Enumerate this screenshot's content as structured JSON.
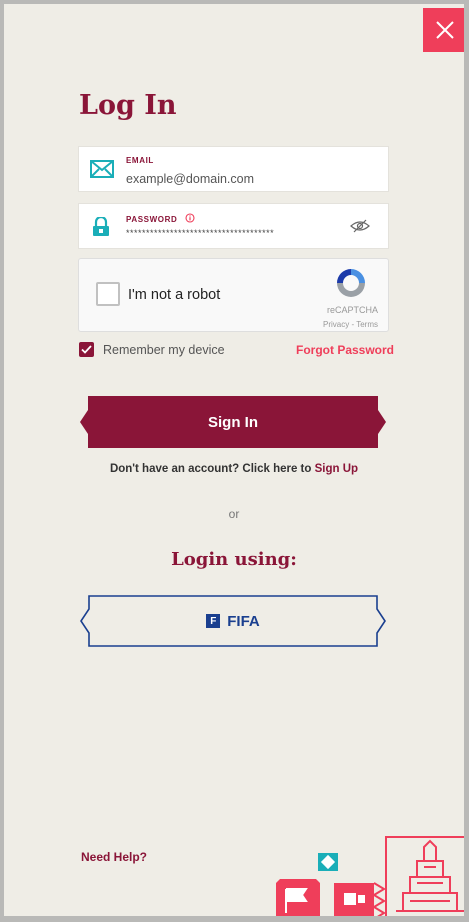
{
  "title": "Log In",
  "email": {
    "label": "EMAIL",
    "placeholder": "example@domain.com"
  },
  "password": {
    "label": "PASSWORD",
    "masked_value": "*************************************"
  },
  "captcha": {
    "label": "I'm not a robot",
    "brand": "reCAPTCHA",
    "privacy": "Privacy",
    "separator": " - ",
    "terms": "Terms"
  },
  "remember": {
    "label": "Remember my device",
    "checked": true
  },
  "forgot_label": "Forgot Password",
  "signin_label": "Sign In",
  "signup": {
    "prompt": "Don't have an account? Click here to ",
    "link": "Sign Up"
  },
  "or_label": "or",
  "login_using_label": "Login using:",
  "fifa": {
    "icon_letter": "F",
    "label": "FIFA"
  },
  "need_help_label": "Need Help?",
  "colors": {
    "maroon": "#8a1538",
    "accent": "#ef3e5a",
    "teal": "#1aaeb8",
    "fifa_blue": "#1a3f8f",
    "background": "#efede6"
  }
}
